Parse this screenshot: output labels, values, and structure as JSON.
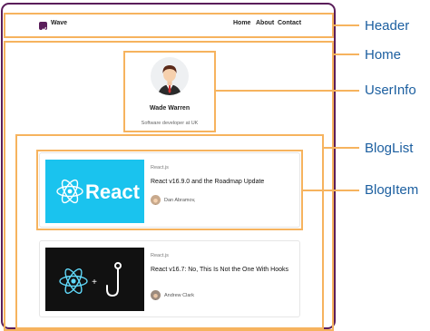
{
  "header": {
    "brand": "Wave",
    "nav": [
      "Home",
      "About",
      "Contact"
    ]
  },
  "user": {
    "name": "Wade Warren",
    "bio": "Software developer at UK"
  },
  "posts": [
    {
      "thumbnail_text": "React",
      "category": "React.js",
      "title": "React v16.9.0 and the Roadmap Update",
      "author": "Dan Abramov,"
    },
    {
      "thumbnail_text": "+",
      "category": "React.js",
      "title": "React v16.7: No, This Is Not the One With Hooks",
      "author": "Andrew Clark"
    }
  ],
  "labels": {
    "header": "Header",
    "home": "Home",
    "userinfo": "UserInfo",
    "bloglist": "BlogList",
    "blogitem": "BlogItem"
  },
  "colors": {
    "frame": "#5a1e5a",
    "box_border": "#f6b35e",
    "label": "#1c5fa0",
    "react_thumbnail_bg": "#1ac3ee",
    "react_logo": "#61dafb"
  },
  "icons": {
    "logo": "logo-icon",
    "react": "react-logo-icon",
    "hook": "hook-icon",
    "avatar": "user-avatar-icon"
  }
}
